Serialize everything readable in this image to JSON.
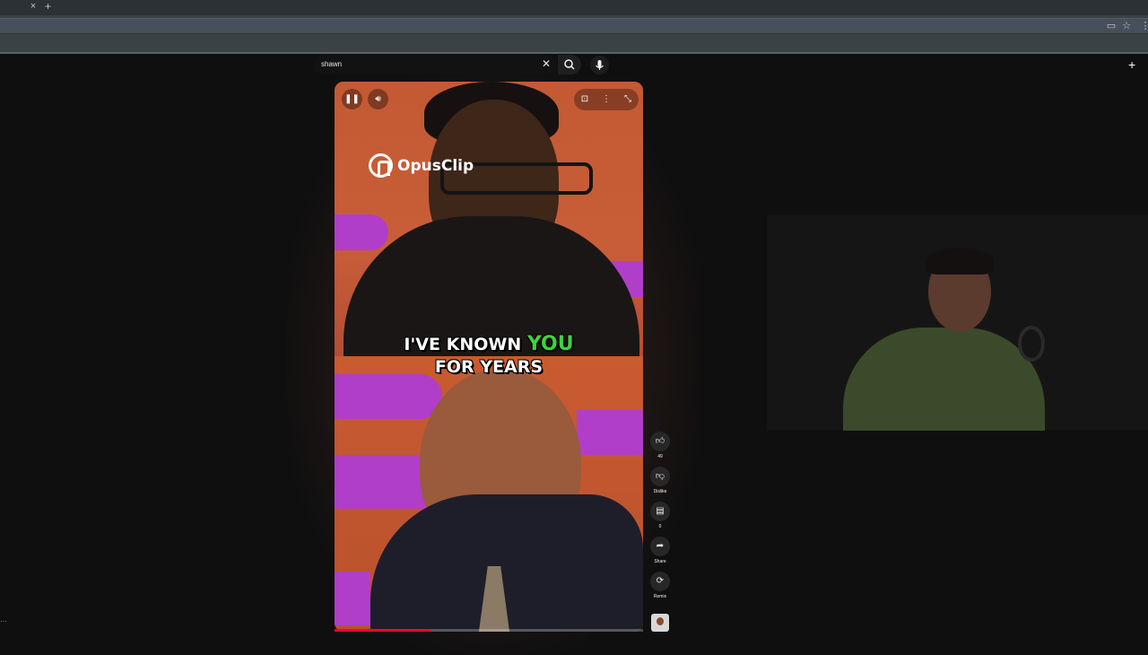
{
  "browser": {
    "tab_close": "×",
    "new_tab": "+"
  },
  "search": {
    "query": "shawn",
    "clear_icon": "close-icon",
    "search_icon": "search-icon",
    "mic_icon": "microphone-icon"
  },
  "video": {
    "watermark": "OpusClip",
    "caption_line1_pre": "I'VE KNOWN ",
    "caption_line1_highlight": "YOU",
    "caption_line2": "FOR YEARS",
    "progress_fraction": 0.31
  },
  "actions": {
    "like_count": "49",
    "dislike_label": "Dislike",
    "comments_count": "0",
    "share_label": "Share",
    "remix_label": "Remix"
  },
  "colors": {
    "caption_highlight": "#3ad63a",
    "progress": "#ff0033"
  }
}
